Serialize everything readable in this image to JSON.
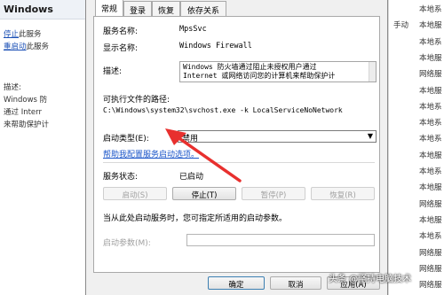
{
  "left_pane": {
    "title": "Windows",
    "stop_link": "停止",
    "stop_suffix": "此服务",
    "restart_link": "重启动",
    "restart_suffix": "此服务",
    "desc_label": "描述:",
    "desc_line1": "Windows 防",
    "desc_line2": "通过 Interr",
    "desc_line3": "来帮助保护计"
  },
  "right_list": {
    "rows": [
      {
        "c1": "",
        "c2": "本地系"
      },
      {
        "c1": "手动",
        "c2": "本地服"
      },
      {
        "c1": "",
        "c2": "本地系"
      },
      {
        "c1": "",
        "c2": "本地服"
      },
      {
        "c1": "",
        "c2": "网络服"
      },
      {
        "c1": "",
        "c2": "本地服"
      },
      {
        "c1": "",
        "c2": "本地系"
      },
      {
        "c1": "",
        "c2": "本地系"
      },
      {
        "c1": "",
        "c2": "本地系"
      },
      {
        "c1": "",
        "c2": "本地服"
      },
      {
        "c1": "",
        "c2": "本地系"
      },
      {
        "c1": "",
        "c2": "本地服"
      },
      {
        "c1": "",
        "c2": "网络服"
      },
      {
        "c1": "",
        "c2": "本地服"
      },
      {
        "c1": "",
        "c2": "本地系"
      },
      {
        "c1": "",
        "c2": "网络服"
      },
      {
        "c1": "",
        "c2": "网络服"
      },
      {
        "c1": "",
        "c2": "网络服"
      }
    ]
  },
  "dialog": {
    "tabs": [
      "常规",
      "登录",
      "恢复",
      "依存关系"
    ],
    "service_name_label": "服务名称:",
    "service_name_value": "MpsSvc",
    "display_name_label": "显示名称:",
    "display_name_value": "Windows Firewall",
    "description_label": "描述:",
    "description_line1": "Windows 防火墙通过阻止未授权用户通过",
    "description_line2": "Internet 或网络访问您的计算机来帮助保护计",
    "exe_path_label": "可执行文件的路径:",
    "exe_path_value": "C:\\Windows\\system32\\svchost.exe -k LocalServiceNoNetwork",
    "startup_type_label": "启动类型(E):",
    "startup_type_value": "禁用",
    "help_link": "帮助我配置服务启动选项。",
    "status_label": "服务状态:",
    "status_value": "已启动",
    "buttons": {
      "start": "启动(S)",
      "stop": "停止(T)",
      "pause": "暂停(P)",
      "resume": "恢复(R)"
    },
    "hint_text": "当从此处启动服务时，您可指定所适用的启动参数。",
    "start_params_label": "启动参数(M):",
    "ok": "确定",
    "cancel": "取消",
    "apply": "应用(A)"
  },
  "watermark": "头条 @坚持电脑技术",
  "colors": {
    "link": "#1a55c9",
    "arrow": "#e8302e"
  }
}
